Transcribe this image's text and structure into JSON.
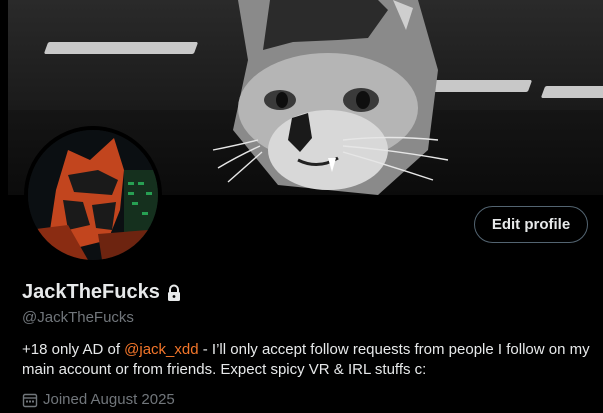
{
  "profile": {
    "display_name": "JackTheFucks",
    "handle": "@JackTheFucks",
    "bio": {
      "prefix": "+18 only AD of ",
      "mention": "@jack_xdd",
      "suffix": " - I’ll only accept follow requests from people I follow on my main account or from friends. Expect spicy VR & IRL stuffs c:"
    },
    "joined": "Joined August 2025",
    "locked_icon": "lock-icon"
  },
  "actions": {
    "edit_profile_label": "Edit profile"
  },
  "colors": {
    "background": "#000000",
    "text_primary": "#e7e9ea",
    "text_secondary": "#71767b",
    "mention": "#f4762a",
    "button_border": "#536471"
  },
  "icons": {
    "joined": "calendar-icon"
  }
}
